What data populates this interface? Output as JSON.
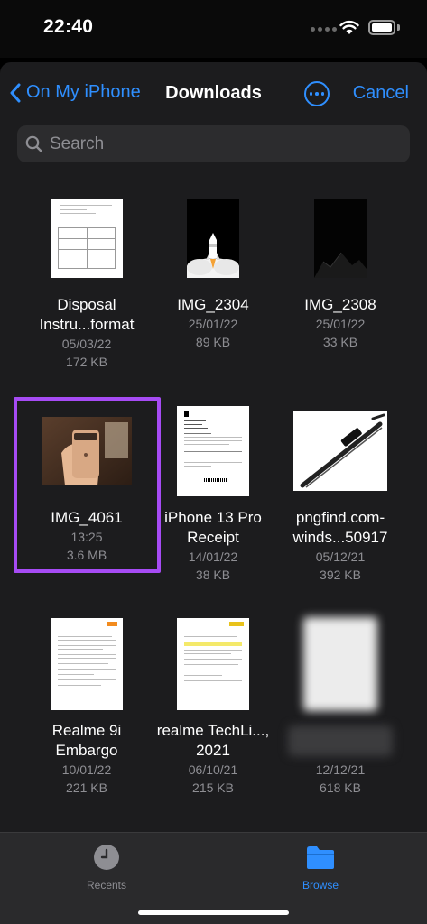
{
  "status": {
    "time": "22:40"
  },
  "nav": {
    "back_label": "On My iPhone",
    "title": "Downloads",
    "cancel_label": "Cancel"
  },
  "search": {
    "placeholder": "Search"
  },
  "files": [
    {
      "name": "Disposal Instru...format",
      "date": "05/03/22",
      "size": "172 KB",
      "thumb": "document"
    },
    {
      "name": "IMG_2304",
      "date": "25/01/22",
      "size": "89 KB",
      "thumb": "rocket"
    },
    {
      "name": "IMG_2308",
      "date": "25/01/22",
      "size": "33 KB",
      "thumb": "dark-mountain"
    },
    {
      "name": "IMG_4061",
      "date": "13:25",
      "size": "3.6 MB",
      "thumb": "phone-photo",
      "selected": true
    },
    {
      "name": "iPhone 13 Pro Receipt",
      "date": "14/01/22",
      "size": "38 KB",
      "thumb": "receipt"
    },
    {
      "name": "pngfind.com-winds...50917",
      "date": "05/12/21",
      "size": "392 KB",
      "thumb": "wiper"
    },
    {
      "name": "Realme 9i Embargo",
      "date": "10/01/22",
      "size": "221 KB",
      "thumb": "document-orange"
    },
    {
      "name": "realme TechLi..., 2021",
      "date": "06/10/21",
      "size": "215 KB",
      "thumb": "document-yellow"
    },
    {
      "name": "",
      "date": "12/12/21",
      "size": "618 KB",
      "thumb": "blurred"
    }
  ],
  "tabs": [
    {
      "label": "Recents",
      "icon": "clock-icon",
      "active": false
    },
    {
      "label": "Browse",
      "icon": "folder-icon",
      "active": true
    }
  ],
  "colors": {
    "accent": "#2f8fff",
    "selection": "#a64bf4",
    "background": "#1c1c1e"
  }
}
